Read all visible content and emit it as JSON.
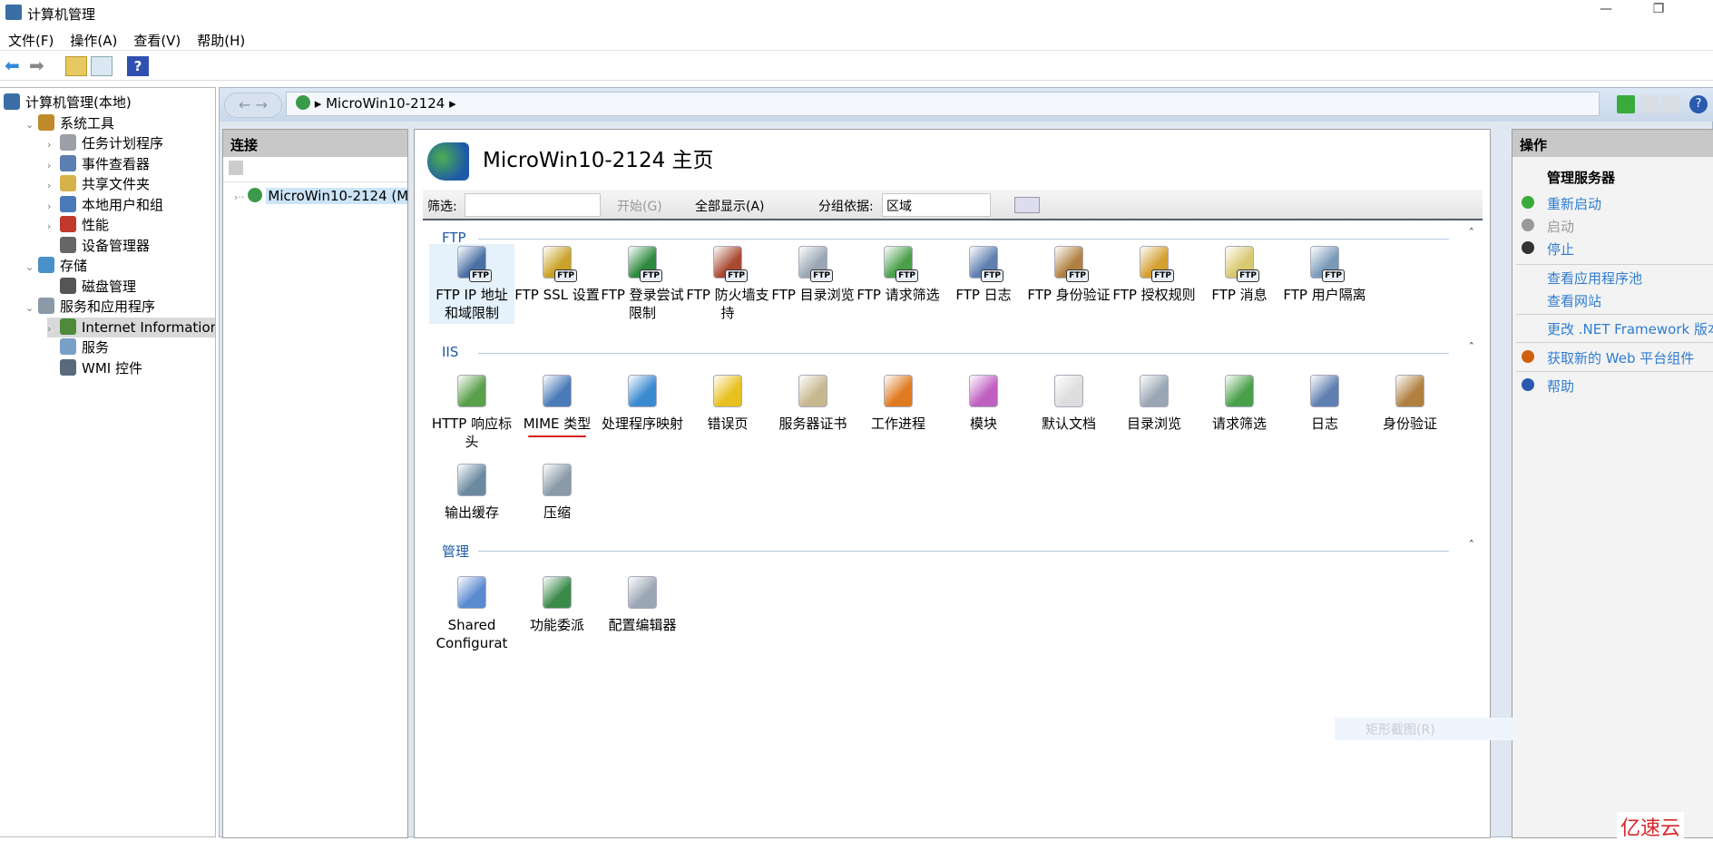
{
  "window": {
    "title": "计算机管理",
    "minimize": "—",
    "restore": "❐"
  },
  "menu": [
    "文件(F)",
    "操作(A)",
    "查看(V)",
    "帮助(H)"
  ],
  "toolbar": {
    "icons": [
      "back-arrow-icon",
      "forward-arrow-icon",
      "up-folder-icon",
      "show-hide-tree-icon",
      "help-icon"
    ],
    "help": "?"
  },
  "tree": [
    {
      "label": "计算机管理(本地)",
      "level": 0,
      "expander": "",
      "color": "#3a6ea5"
    },
    {
      "label": "系统工具",
      "level": 1,
      "expander": "⌄",
      "color": "#c08a2a"
    },
    {
      "label": "任务计划程序",
      "level": 2,
      "expander": "›",
      "color": "#9aa0a6"
    },
    {
      "label": "事件查看器",
      "level": 2,
      "expander": "›",
      "color": "#5a7fb0"
    },
    {
      "label": "共享文件夹",
      "level": 2,
      "expander": "›",
      "color": "#d6b24a"
    },
    {
      "label": "本地用户和组",
      "level": 2,
      "expander": "›",
      "color": "#4a7ab8"
    },
    {
      "label": "性能",
      "level": 2,
      "expander": "›",
      "color": "#c0392b"
    },
    {
      "label": "设备管理器",
      "level": 2,
      "expander": "",
      "color": "#666"
    },
    {
      "label": "存储",
      "level": 1,
      "expander": "⌄",
      "color": "#4a90c8"
    },
    {
      "label": "磁盘管理",
      "level": 2,
      "expander": "",
      "color": "#555"
    },
    {
      "label": "服务和应用程序",
      "level": 1,
      "expander": "⌄",
      "color": "#8a9aa8"
    },
    {
      "label": "Internet Information Se",
      "level": 2,
      "expander": "›",
      "color": "#4f8a3a",
      "selected": true
    },
    {
      "label": "服务",
      "level": 2,
      "expander": "",
      "color": "#7aa0c8"
    },
    {
      "label": "WMI 控件",
      "level": 2,
      "expander": "",
      "color": "#5a6a7a"
    }
  ],
  "address": {
    "back": "←",
    "forward": "→",
    "path": "MicroWin10-2124",
    "sep": "▸"
  },
  "connections": {
    "header": "连接",
    "node": "MicroWin10-2124 (M"
  },
  "center": {
    "title": "MicroWin10-2124 主页",
    "filter": {
      "label": "筛选:",
      "value": "",
      "start": "开始(G)",
      "show_all": "全部显示(A)",
      "group_label": "分组依据:",
      "group_value": "区域"
    },
    "sections": [
      {
        "name": "FTP",
        "items": [
          {
            "label": "FTP IP 地址和域限制",
            "color": "#4a6fa5",
            "ftp": true
          },
          {
            "label": "FTP SSL 设置",
            "color": "#c9a227",
            "ftp": true
          },
          {
            "label": "FTP 登录尝试限制",
            "color": "#2f8a3f",
            "ftp": true
          },
          {
            "label": "FTP 防火墙支持",
            "color": "#a84a32",
            "ftp": true
          },
          {
            "label": "FTP 目录浏览",
            "color": "#9aa6b4",
            "ftp": true
          },
          {
            "label": "FTP 请求筛选",
            "color": "#4aa04a",
            "ftp": true
          },
          {
            "label": "FTP 日志",
            "color": "#5f7fb0",
            "ftp": true
          },
          {
            "label": "FTP 身份验证",
            "color": "#b08040",
            "ftp": true
          },
          {
            "label": "FTP 授权规则",
            "color": "#d4a030",
            "ftp": true
          },
          {
            "label": "FTP 消息",
            "color": "#d8c870",
            "ftp": true
          },
          {
            "label": "FTP 用户隔离",
            "color": "#7a9ab8",
            "ftp": true
          }
        ]
      },
      {
        "name": "IIS",
        "items": [
          {
            "label": "HTTP 响应标头",
            "color": "#5aa04a"
          },
          {
            "label": "MIME 类型",
            "color": "#4a7ab8"
          },
          {
            "label": "处理程序映射",
            "color": "#3a8ad0"
          },
          {
            "label": "错误页",
            "color": "#e8c020"
          },
          {
            "label": "服务器证书",
            "color": "#c8b890"
          },
          {
            "label": "工作进程",
            "color": "#e07a20"
          },
          {
            "label": "模块",
            "color": "#c060c0"
          },
          {
            "label": "默认文档",
            "color": "#ddd"
          },
          {
            "label": "目录浏览",
            "color": "#9aa6b4"
          },
          {
            "label": "请求筛选",
            "color": "#4aa04a"
          },
          {
            "label": "日志",
            "color": "#5f7fb0"
          },
          {
            "label": "身份验证",
            "color": "#b08040"
          },
          {
            "label": "输出缓存",
            "color": "#6a8aa0"
          },
          {
            "label": "压缩",
            "color": "#8a9aa8"
          }
        ]
      },
      {
        "name": "管理",
        "items": [
          {
            "label": "Shared Configurat",
            "color": "#5a8ad0"
          },
          {
            "label": "功能委派",
            "color": "#3a8a4a"
          },
          {
            "label": "配置编辑器",
            "color": "#9aa6b4"
          }
        ]
      }
    ],
    "collapse": "ˆ"
  },
  "actions": {
    "header": "操作",
    "group": "管理服务器",
    "items": [
      {
        "label": "重新启动",
        "icon": "restart-icon",
        "color": "#3aaa3a",
        "enabled": true
      },
      {
        "label": "启动",
        "icon": "start-icon",
        "color": "#999",
        "enabled": false
      },
      {
        "label": "停止",
        "icon": "stop-icon",
        "color": "#333",
        "enabled": true
      },
      {
        "label": "查看应用程序池",
        "enabled": true
      },
      {
        "label": "查看网站",
        "enabled": true
      },
      {
        "label": "更改 .NET Framework 版本",
        "enabled": true
      },
      {
        "label": "获取新的 Web 平台组件",
        "icon": "web-platform-icon",
        "color": "#d06010",
        "enabled": true
      },
      {
        "label": "帮助",
        "icon": "help-icon",
        "color": "#2a5ab0",
        "enabled": true
      }
    ]
  },
  "overlay": {
    "snip": "矩形截图(R)",
    "logo": "亿速云"
  },
  "annotation_color": "#d81e1e"
}
